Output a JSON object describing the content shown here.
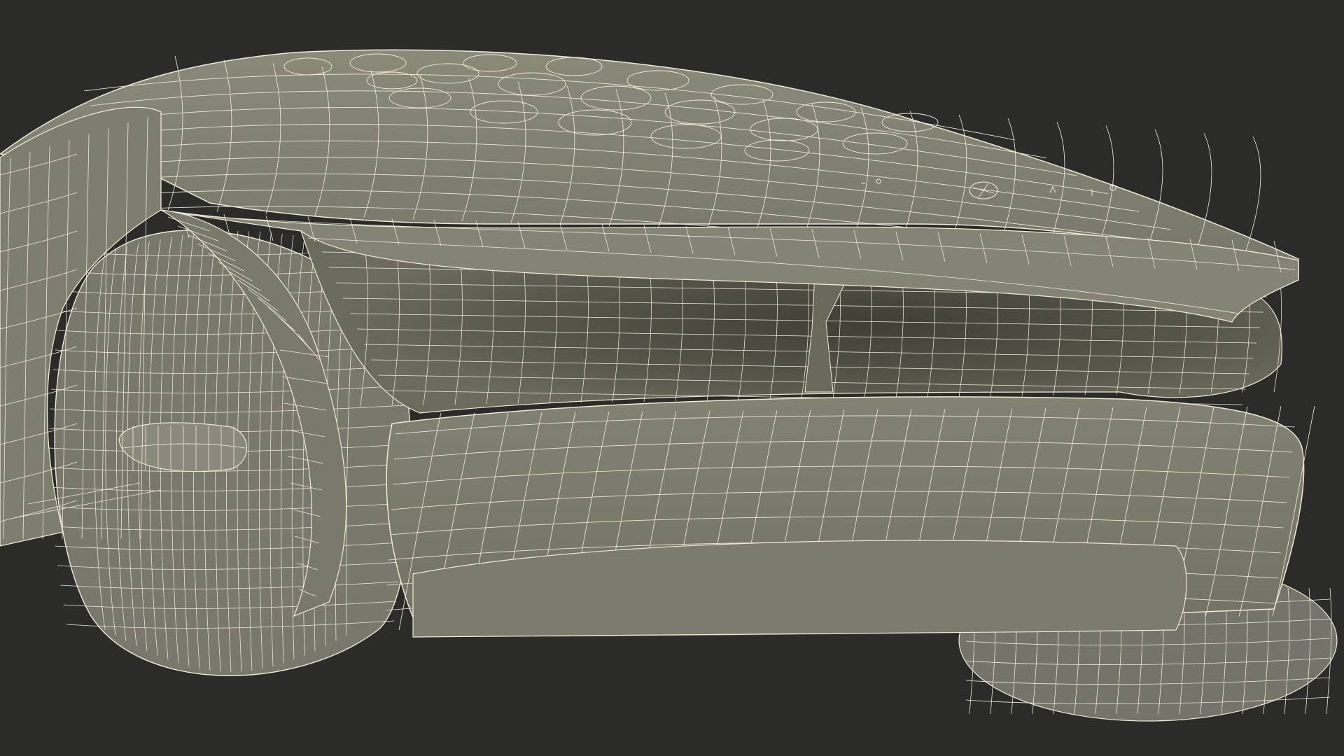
{
  "scene": {
    "subject": "wireframe-render-concept-car-rear",
    "colors": {
      "background": "#2b2b2a",
      "body": "#7b7b6b",
      "body_light": "#868675",
      "body_dark": "#6a6a5b",
      "cavity": "#5e5e51",
      "cavity_deep": "#4b4b41",
      "wheel": "#75756a",
      "wire": "#ecebd6"
    }
  }
}
